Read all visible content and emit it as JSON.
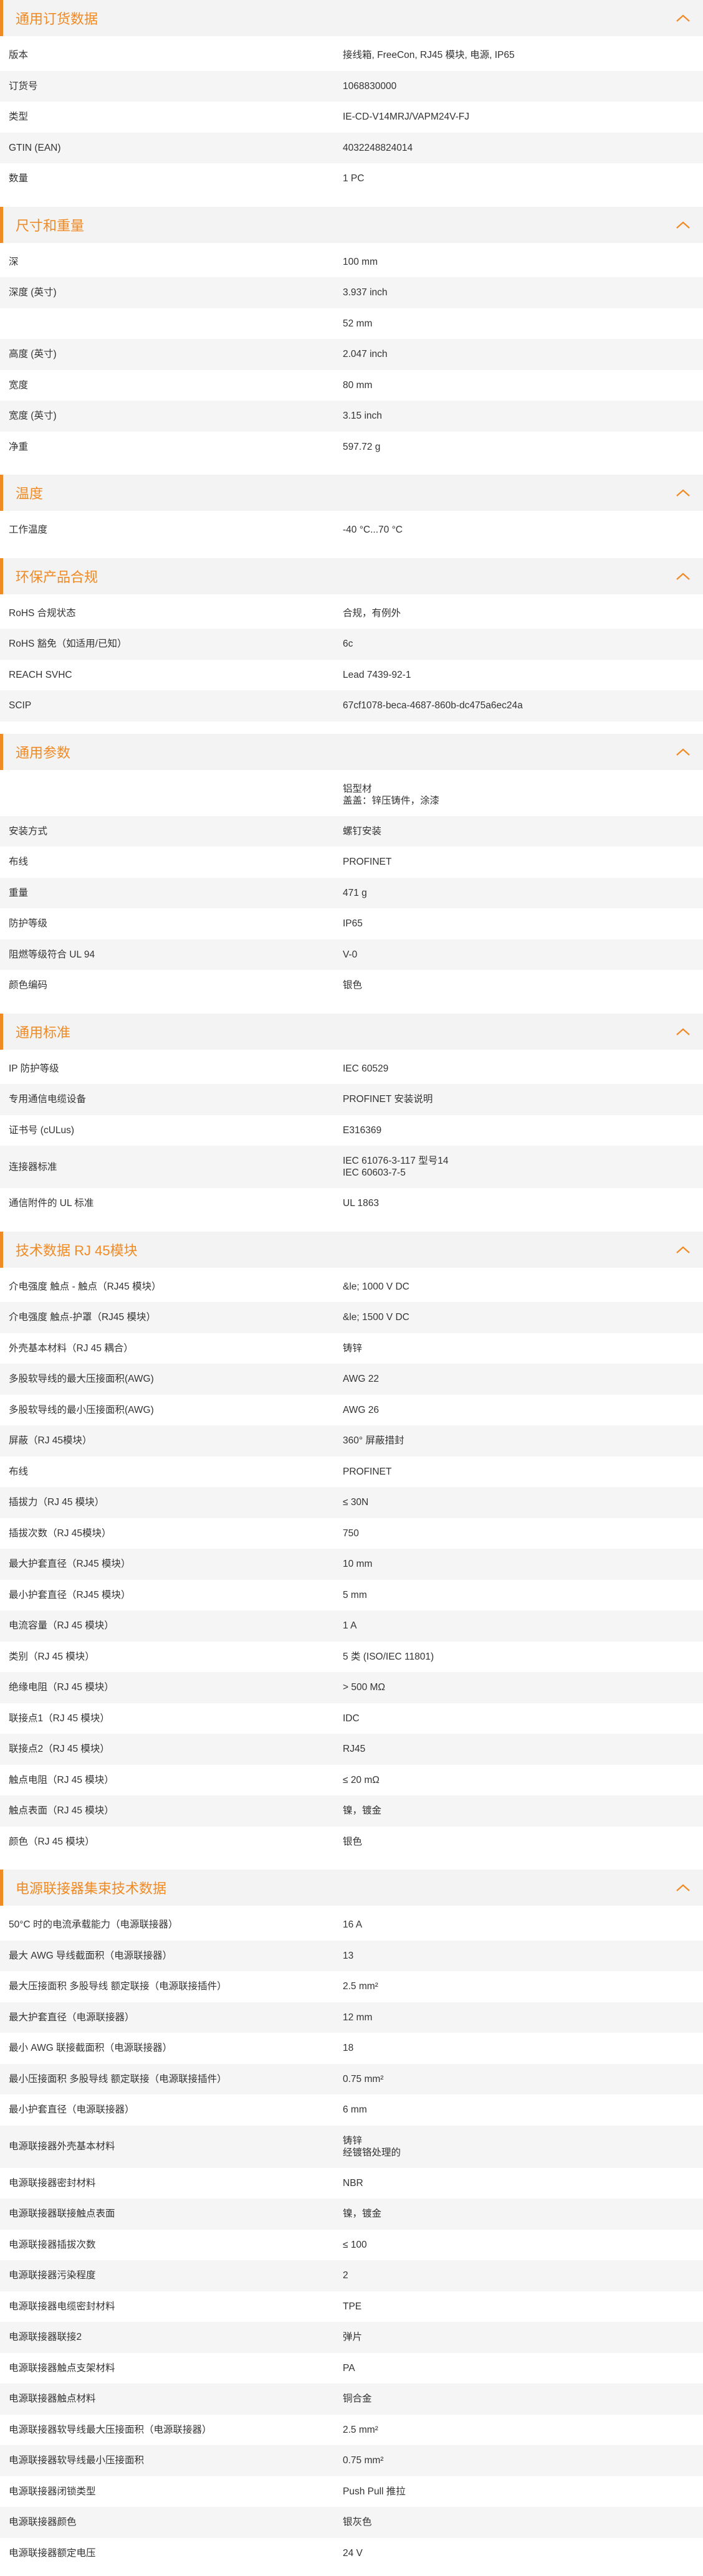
{
  "sections": [
    {
      "title": "通用订货数据",
      "rows": [
        {
          "label": "版本",
          "value": "接线箱, FreeCon, RJ45 模块, 电源, IP65"
        },
        {
          "label": "订货号",
          "value": "1068830000"
        },
        {
          "label": "类型",
          "value": "IE-CD-V14MRJ/VAPM24V-FJ"
        },
        {
          "label": "GTIN (EAN)",
          "value": "4032248824014"
        },
        {
          "label": "数量",
          "value": "1  PC"
        }
      ]
    },
    {
      "title": "尺寸和重量",
      "rows": [
        {
          "label": "深",
          "value": "100  mm"
        },
        {
          "label": "深度 (英寸)",
          "value": "3.937  inch"
        },
        {
          "label": "",
          "value": "52  mm"
        },
        {
          "label": "高度 (英寸)",
          "value": "2.047  inch"
        },
        {
          "label": "宽度",
          "value": "80  mm"
        },
        {
          "label": "宽度 (英寸)",
          "value": "3.15  inch"
        },
        {
          "label": "净重",
          "value": "597.72  g"
        }
      ]
    },
    {
      "title": "温度",
      "rows": [
        {
          "label": "工作温度",
          "value": "-40 °C...70 °C"
        }
      ]
    },
    {
      "title": "环保产品合规",
      "rows": [
        {
          "label": "RoHS 合规状态",
          "value": "合规，有例外"
        },
        {
          "label": "RoHS 豁免（如适用/已知）",
          "value": "6c"
        },
        {
          "label": "REACH SVHC",
          "value": "Lead 7439-92-1"
        },
        {
          "label": "SCIP",
          "value": "67cf1078-beca-4687-860b-dc475a6ec24a"
        }
      ]
    },
    {
      "title": "通用参数",
      "rows": [
        {
          "label": "",
          "value": "铝型材\n盖盖：锌压铸件，涂漆"
        },
        {
          "label": "安装方式",
          "value": "螺钉安装"
        },
        {
          "label": "布线",
          "value": "PROFINET"
        },
        {
          "label": "重量",
          "value": "471  g"
        },
        {
          "label": "防护等级",
          "value": "IP65"
        },
        {
          "label": "阻燃等级符合 UL 94",
          "value": "V-0"
        },
        {
          "label": "颜色编码",
          "value": "银色"
        }
      ]
    },
    {
      "title": "通用标准",
      "rows": [
        {
          "label": "IP 防护等级",
          "value": "IEC 60529"
        },
        {
          "label": "专用通信电缆设备",
          "value": "PROFINET 安装说明"
        },
        {
          "label": "证书号 (cULus)",
          "value": "E316369"
        },
        {
          "label": "连接器标准",
          "value": "IEC 61076-3-117 型号14\nIEC 60603-7-5"
        },
        {
          "label": "通信附件的 UL 标准",
          "value": "UL 1863"
        }
      ]
    },
    {
      "title": "技术数据 RJ 45模块",
      "rows": [
        {
          "label": "介电强度 触点 - 触点（RJ45 模块）",
          "value": "&le; 1000 V DC"
        },
        {
          "label": "介电强度 触点-护罩（RJ45 模块）",
          "value": "&le; 1500 V DC"
        },
        {
          "label": "外壳基本材料（RJ 45 耦合）",
          "value": "铸锌"
        },
        {
          "label": "多股软导线的最大压接面积(AWG)",
          "value": "AWG 22"
        },
        {
          "label": "多股软导线的最小压接面积(AWG)",
          "value": "AWG 26"
        },
        {
          "label": "屏蔽（RJ 45模块）",
          "value": "360° 屏蔽措封"
        },
        {
          "label": "布线",
          "value": "PROFINET"
        },
        {
          "label": "插拔力（RJ 45 模块）",
          "value": "≤ 30N"
        },
        {
          "label": "插拔次数（RJ 45模块）",
          "value": "750"
        },
        {
          "label": "最大护套直径（RJ45 模块）",
          "value": "10  mm"
        },
        {
          "label": "最小护套直径（RJ45 模块）",
          "value": "5  mm"
        },
        {
          "label": "电流容量（RJ 45 模块）",
          "value": "1 A"
        },
        {
          "label": "类别（RJ 45 模块）",
          "value": "5 类 (ISO/IEC 11801)"
        },
        {
          "label": "绝缘电阻（RJ 45 模块）",
          "value": "> 500 MΩ"
        },
        {
          "label": "联接点1（RJ 45 模块）",
          "value": "IDC"
        },
        {
          "label": "联接点2（RJ 45 模块）",
          "value": "RJ45"
        },
        {
          "label": "触点电阻（RJ 45 模块）",
          "value": "≤ 20 mΩ"
        },
        {
          "label": "触点表面（RJ 45 模块）",
          "value": "镍，镀金"
        },
        {
          "label": "颜色（RJ 45 模块）",
          "value": "银色"
        }
      ]
    },
    {
      "title": "电源联接器集束技术数据",
      "rows": [
        {
          "label": "50°C 时的电流承载能力（电源联接器）",
          "value": "16  A"
        },
        {
          "label": "最大 AWG 导线截面积（电源联接器）",
          "value": "13"
        },
        {
          "label": "最大压接面积 多股导线 额定联接（电源联接插件）",
          "value": "2.5  mm²"
        },
        {
          "label": "最大护套直径（电源联接器）",
          "value": "12  mm"
        },
        {
          "label": "最小 AWG 联接截面积（电源联接器）",
          "value": "18"
        },
        {
          "label": "最小压接面积 多股导线 额定联接（电源联接插件）",
          "value": "0.75  mm²"
        },
        {
          "label": "最小护套直径（电源联接器）",
          "value": "6  mm"
        },
        {
          "label": "电源联接器外壳基本材料",
          "value": "铸锌\n经镀铬处理的"
        },
        {
          "label": "电源联接器密封材料",
          "value": "NBR"
        },
        {
          "label": "电源联接器联接触点表面",
          "value": "镍，镀金"
        },
        {
          "label": "电源联接器插拔次数",
          "value": "≤ 100"
        },
        {
          "label": "电源联接器污染程度",
          "value": "2"
        },
        {
          "label": "电源联接器电缆密封材料",
          "value": "TPE"
        },
        {
          "label": "电源联接器联接2",
          "value": "弹片"
        },
        {
          "label": "电源联接器触点支架材料",
          "value": "PA"
        },
        {
          "label": "电源联接器触点材料",
          "value": "铜合金"
        },
        {
          "label": "电源联接器软导线最大压接面积（电源联接器）",
          "value": "2.5  mm²"
        },
        {
          "label": "电源联接器软导线最小压接面积",
          "value": "0.75  mm²"
        },
        {
          "label": "电源联接器闭锁类型",
          "value": "Push Pull 推拉"
        },
        {
          "label": "电源联接器颜色",
          "value": "银灰色"
        },
        {
          "label": "电源联接器额定电压",
          "value": "24  V"
        }
      ]
    }
  ]
}
